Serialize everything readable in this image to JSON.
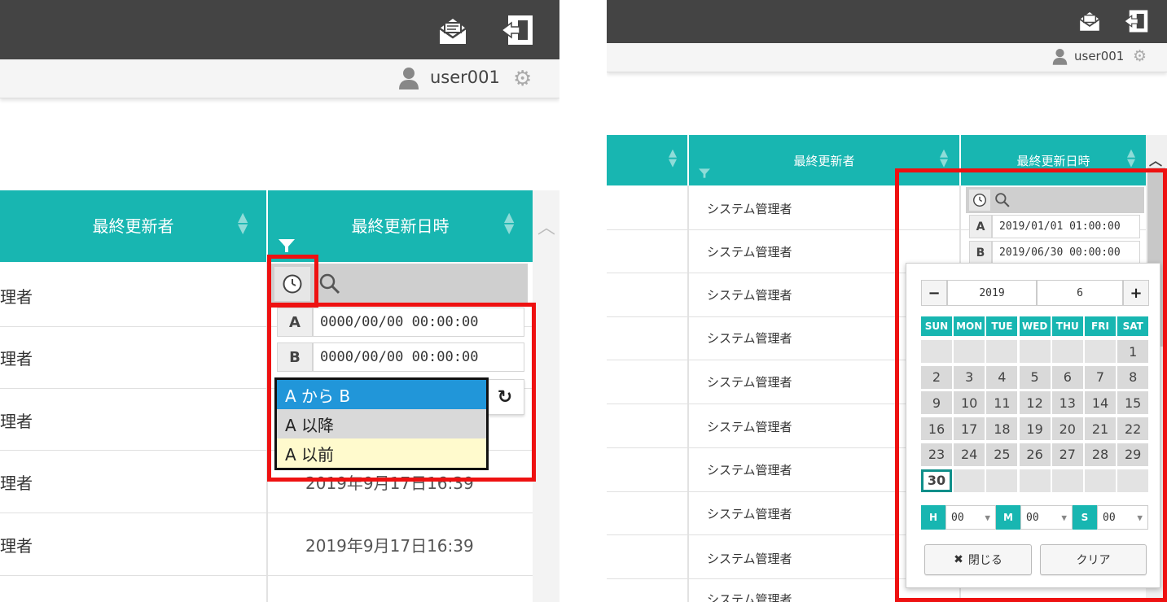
{
  "header": {
    "user_name": "user001"
  },
  "colors": {
    "teal": "#18b6b1",
    "red_highlight": "#ee1111",
    "option_selected": "#2196d9",
    "option_hover": "#d9d9d9",
    "option_yellow": "#fffacd"
  },
  "left": {
    "col_author": "最終更新者",
    "col_datetime": "最終更新日時",
    "rows": [
      {
        "author": "理者",
        "datetime": ""
      },
      {
        "author": "理者",
        "datetime": ""
      },
      {
        "author": "理者",
        "datetime": ""
      },
      {
        "author": "理者",
        "datetime": "2019年9月17日16:39"
      },
      {
        "author": "理者",
        "datetime": "2019年9月17日16:39"
      }
    ],
    "filter": {
      "label_a": "A",
      "label_b": "B",
      "value_a": "0000/00/00 00:00:00",
      "value_b": "0000/00/00 00:00:00",
      "range_options": [
        "A から B",
        "A 以降",
        "A 以前"
      ],
      "selected_option": "A から B",
      "stray_text": "9"
    }
  },
  "right": {
    "col_author": "最終更新者",
    "col_datetime": "最終更新日時",
    "rows": [
      "システム管理者",
      "システム管理者",
      "システム管理者",
      "システム管理者",
      "システム管理者",
      "システム管理者",
      "システム管理者",
      "システム管理者",
      "システム管理者",
      "システム管理者"
    ],
    "filter": {
      "label_a": "A",
      "label_b": "B",
      "value_a": "2019/01/01 01:00:00",
      "value_b": "2019/06/30 00:00:00"
    },
    "calendar": {
      "minus": "−",
      "plus": "+",
      "year": "2019",
      "month": "6",
      "weekdays": [
        "SUN",
        "MON",
        "TUE",
        "WED",
        "THU",
        "FRI",
        "SAT"
      ],
      "first_weekday_index": 6,
      "days_in_month": 30,
      "selected_day": 30,
      "time": [
        {
          "label": "H",
          "value": "00"
        },
        {
          "label": "M",
          "value": "00"
        },
        {
          "label": "S",
          "value": "00"
        }
      ],
      "close_label": "閉じる",
      "clear_label": "クリア"
    }
  }
}
